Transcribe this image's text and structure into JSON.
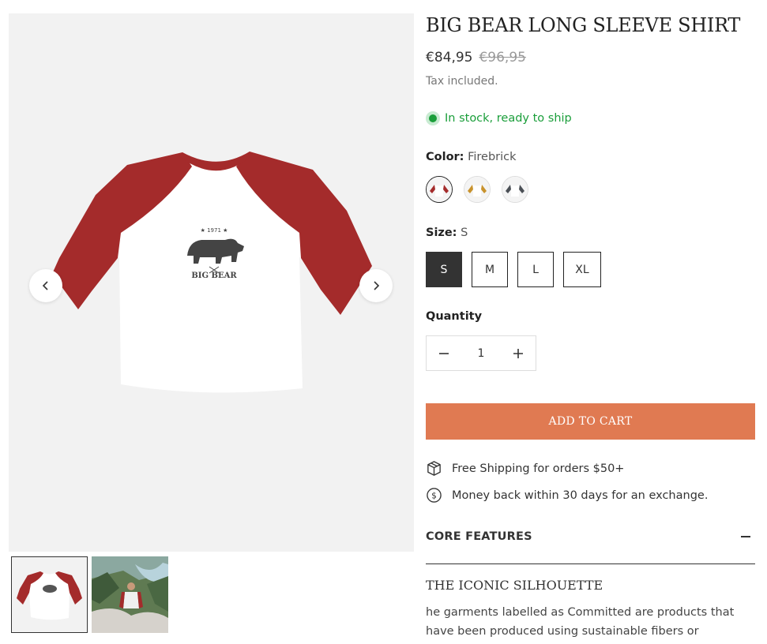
{
  "product": {
    "title": "BIG BEAR LONG SLEEVE SHIRT",
    "price": "€84,95",
    "compare_price": "€96,95",
    "tax_note": "Tax included.",
    "stock": "In stock, ready to ship"
  },
  "color": {
    "label": "Color:",
    "value": "Firebrick",
    "swatches": [
      {
        "name": "Firebrick",
        "hex": "#a42b2b"
      },
      {
        "name": "Mustard",
        "hex": "#c8922c"
      },
      {
        "name": "Charcoal",
        "hex": "#4a4f55"
      }
    ]
  },
  "size": {
    "label": "Size:",
    "value": "S",
    "options": [
      "S",
      "M",
      "L",
      "XL"
    ]
  },
  "quantity": {
    "label": "Quantity",
    "value": "1"
  },
  "cart": {
    "button": "ADD TO CART"
  },
  "features": [
    {
      "icon": "package-icon",
      "text": "Free Shipping for orders $50+"
    },
    {
      "icon": "dollar-circle-icon",
      "text": "Money back within 30 days for an exchange."
    }
  ],
  "core": {
    "label": "CORE FEATURES",
    "subtitle": "THE ICONIC SILHOUETTE",
    "paragraph": "he garments labelled as Committed are products that have been produced using sustainable fibers or"
  },
  "colors": {
    "accent": "#e07a52",
    "stock_green": "#1a9e3a",
    "sleeve_red": "#a42b2b"
  }
}
